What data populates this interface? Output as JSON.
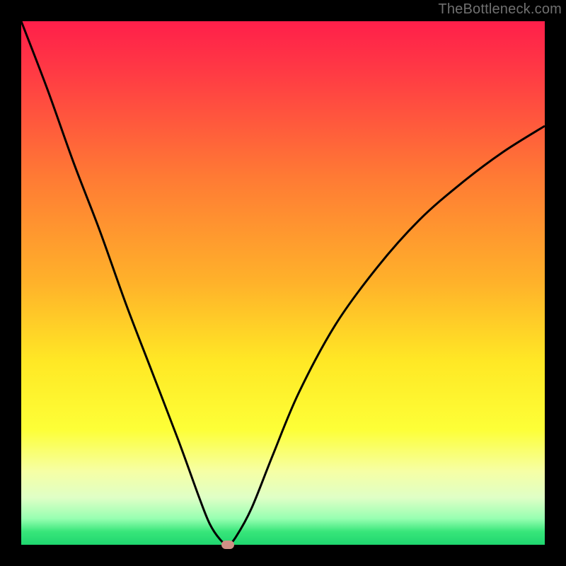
{
  "watermark": "TheBottleneck.com",
  "chart_data": {
    "type": "line",
    "title": "",
    "xlabel": "",
    "ylabel": "",
    "xlim": [
      0,
      100
    ],
    "ylim": [
      0,
      100
    ],
    "grid": false,
    "legend": false,
    "series": [
      {
        "name": "bottleneck-curve",
        "x": [
          0,
          5,
          10,
          15,
          20,
          25,
          30,
          34,
          36,
          38,
          39.5,
          41,
          44,
          48,
          53,
          60,
          68,
          76,
          84,
          92,
          100
        ],
        "y": [
          100,
          87,
          73,
          60,
          46,
          33,
          20,
          9,
          4,
          1,
          0,
          1.5,
          7,
          17,
          29,
          42,
          53,
          62,
          69,
          75,
          80
        ]
      }
    ],
    "marker": {
      "name": "min-point",
      "x": 39.5,
      "y": 0
    },
    "gradient_stops": [
      {
        "offset": 0.0,
        "color": "#ff1f4a"
      },
      {
        "offset": 0.1,
        "color": "#ff3b44"
      },
      {
        "offset": 0.3,
        "color": "#ff7b34"
      },
      {
        "offset": 0.5,
        "color": "#ffb22a"
      },
      {
        "offset": 0.65,
        "color": "#ffe825"
      },
      {
        "offset": 0.78,
        "color": "#fdff37"
      },
      {
        "offset": 0.86,
        "color": "#f6ffa5"
      },
      {
        "offset": 0.91,
        "color": "#dfffc6"
      },
      {
        "offset": 0.95,
        "color": "#97ffb1"
      },
      {
        "offset": 0.975,
        "color": "#38e67a"
      },
      {
        "offset": 1.0,
        "color": "#1fd66f"
      }
    ]
  }
}
